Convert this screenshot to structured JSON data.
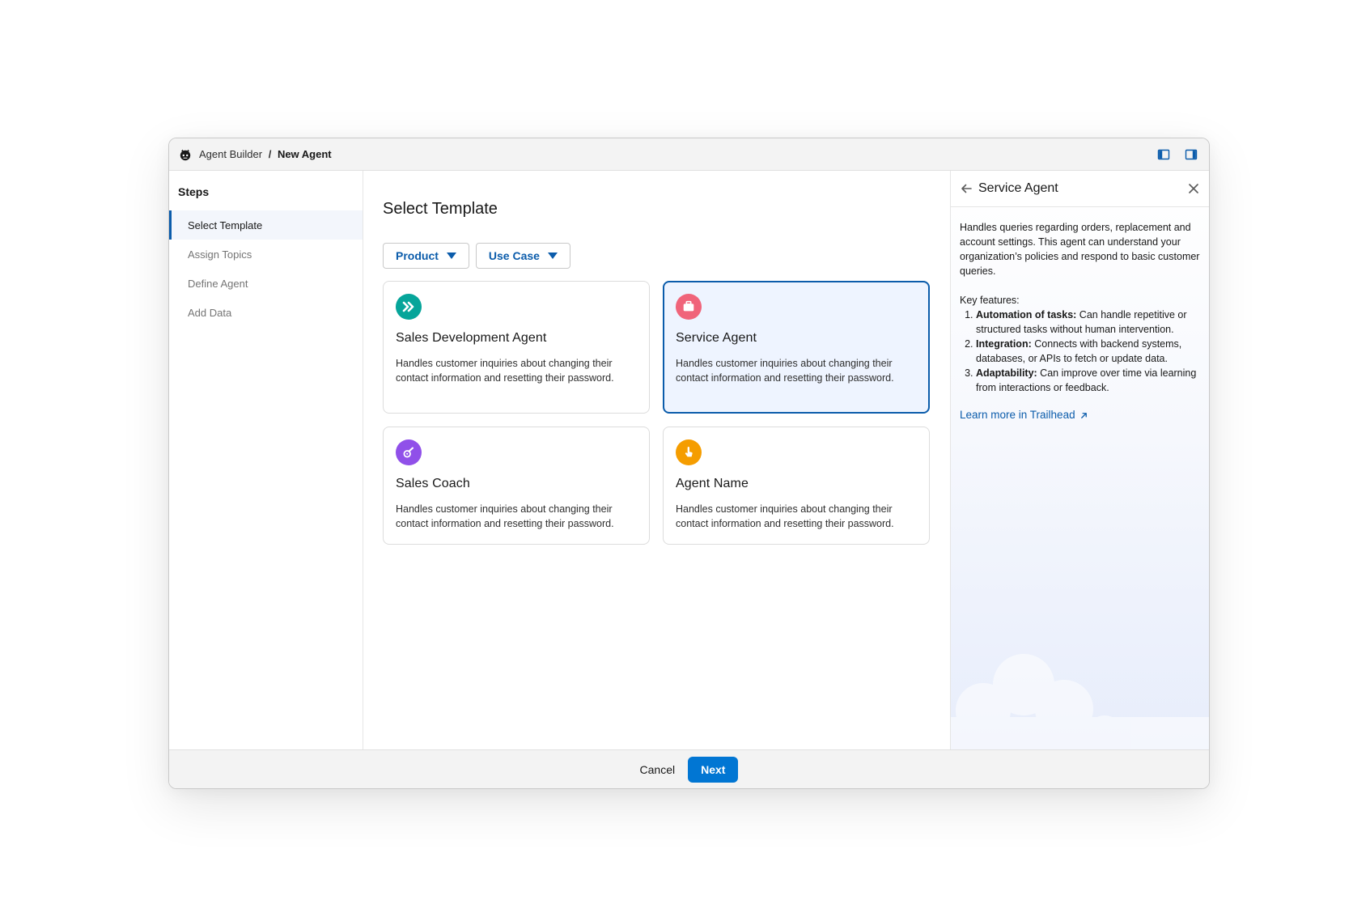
{
  "titlebar": {
    "app_name": "Agent Builder",
    "separator": "/",
    "current": "New Agent"
  },
  "sidebar": {
    "heading": "Steps",
    "items": [
      {
        "label": "Select Template",
        "active": true
      },
      {
        "label": "Assign Topics",
        "active": false
      },
      {
        "label": "Define Agent",
        "active": false
      },
      {
        "label": "Add Data",
        "active": false
      }
    ]
  },
  "main": {
    "title": "Select Template",
    "filters": [
      {
        "label": "Product"
      },
      {
        "label": "Use Case"
      }
    ],
    "cards": [
      {
        "title": "Sales Development Agent",
        "description": "Handles customer inquiries about changing their contact information and resetting their password.",
        "icon": "double-chevron-icon",
        "color": "#06a59a"
      },
      {
        "title": "Service Agent",
        "description": "Handles customer inquiries about changing their contact information and resetting their password.",
        "icon": "briefcase-icon",
        "color": "#f0647a",
        "selected": true
      },
      {
        "title": "Sales Coach",
        "description": "Handles customer inquiries about changing their contact information and resetting their password.",
        "icon": "whistle-icon",
        "color": "#9050e9"
      },
      {
        "title": "Agent Name",
        "description": "Handles customer inquiries about changing their contact information and resetting their password.",
        "icon": "pointer-hand-icon",
        "color": "#f59d00"
      }
    ]
  },
  "panel": {
    "title": "Service Agent",
    "description": "Handles queries regarding orders, replacement and account settings. This agent can understand your organization’s policies and respond to basic customer queries.",
    "features_label": "Key features:",
    "features": [
      {
        "name": "Automation of tasks:",
        "text": " Can handle repetitive or structured tasks without human intervention."
      },
      {
        "name": "Integration:",
        "text": " Connects with backend systems, databases, or APIs to fetch or update data."
      },
      {
        "name": "Adaptability:",
        "text": " Can improve over time via learning from interactions or feedback."
      }
    ],
    "link_label": "Learn more in Trailhead"
  },
  "footer": {
    "cancel_label": "Cancel",
    "next_label": "Next"
  },
  "colors": {
    "brand_blue": "#0b5cab",
    "primary_button": "#0176d3",
    "selected_card_bg": "#eef4ff"
  }
}
